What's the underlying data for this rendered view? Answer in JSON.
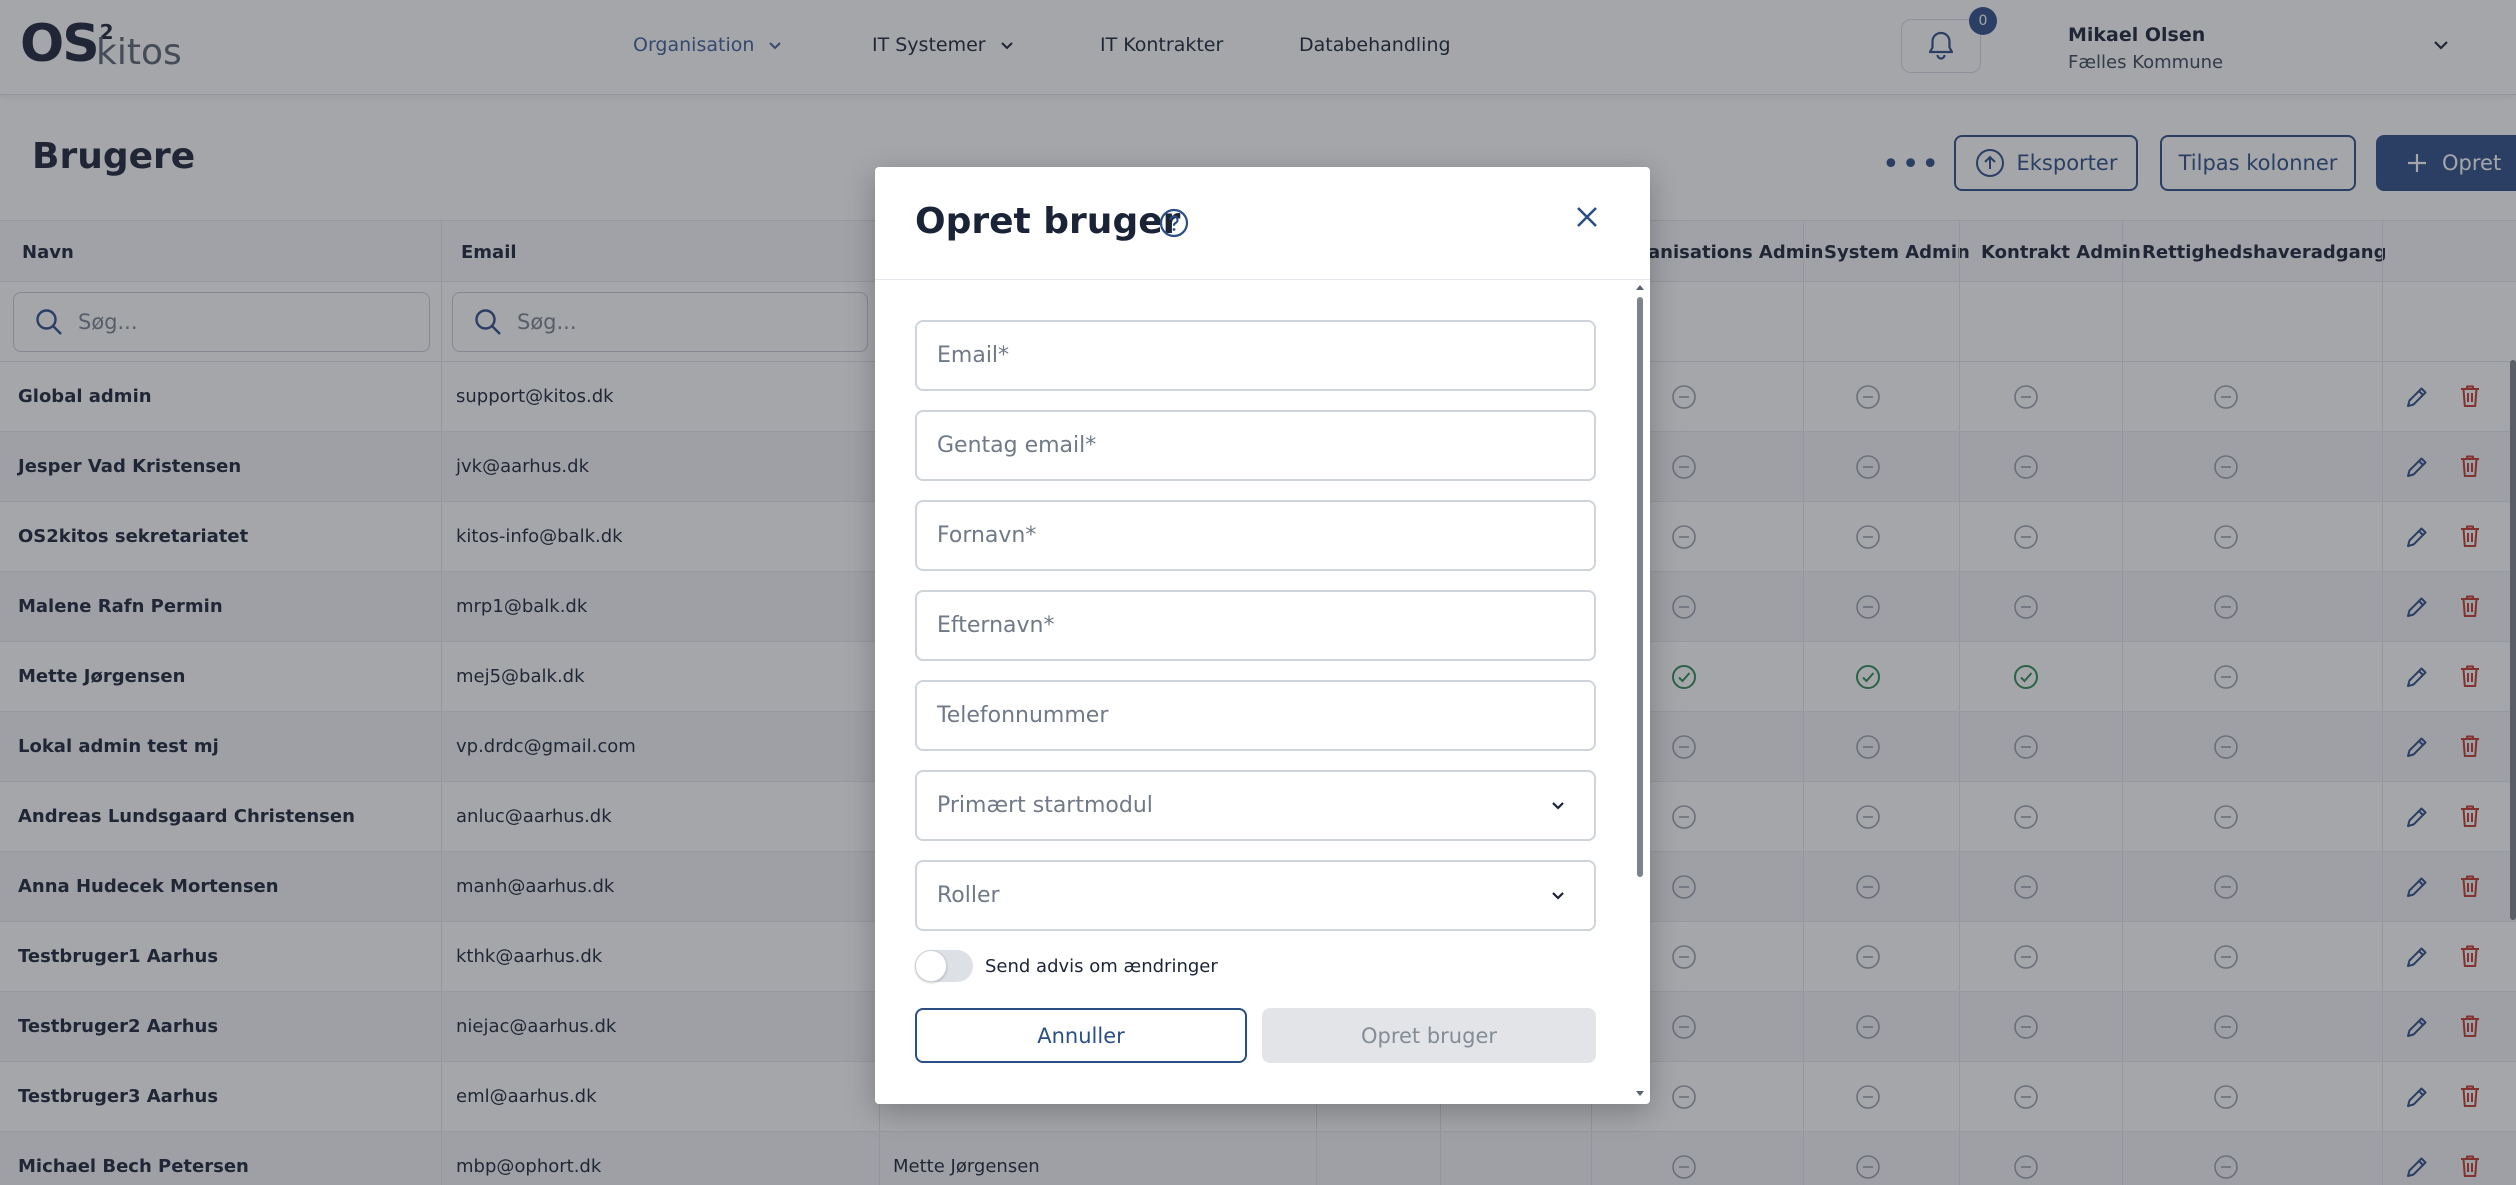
{
  "header": {
    "logo_text": "OS",
    "logo_sup": "2",
    "logo_sub": "kitos",
    "nav": [
      {
        "label": "Organisation",
        "active": true,
        "dropdown": true
      },
      {
        "label": "IT Systemer",
        "active": false,
        "dropdown": true
      },
      {
        "label": "IT Kontrakter",
        "active": false,
        "dropdown": false
      },
      {
        "label": "Databehandling",
        "active": false,
        "dropdown": false
      }
    ],
    "notifications_count": "0",
    "user_name": "Mikael Olsen",
    "user_org": "Fælles Kommune"
  },
  "page": {
    "title": "Brugere",
    "more_icon": "ellipsis-icon",
    "export_label": "Eksporter",
    "columns_label": "Tilpas kolonner",
    "create_label": "Opret"
  },
  "table": {
    "headers": [
      "Navn",
      "Email",
      "anisations Admin",
      "System Admin",
      "Kontrakt Admin",
      "Rettighedshaveradgang"
    ],
    "search_placeholder": "Søg...",
    "rows": [
      {
        "name": "Global admin",
        "email": "support@kitos.dk",
        "extra": "",
        "checks": [
          false,
          false,
          false,
          false
        ]
      },
      {
        "name": "Jesper Vad Kristensen",
        "email": "jvk@aarhus.dk",
        "extra": "",
        "checks": [
          false,
          false,
          false,
          false
        ]
      },
      {
        "name": "OS2kitos sekretariatet",
        "email": "kitos-info@balk.dk",
        "extra": "",
        "checks": [
          false,
          false,
          false,
          false
        ]
      },
      {
        "name": "Malene Rafn Permin",
        "email": "mrp1@balk.dk",
        "extra": "",
        "checks": [
          false,
          false,
          false,
          false
        ]
      },
      {
        "name": "Mette Jørgensen",
        "email": "mej5@balk.dk",
        "extra": "",
        "checks": [
          true,
          true,
          true,
          false
        ]
      },
      {
        "name": "Lokal admin test mj",
        "email": "vp.drdc@gmail.com",
        "extra": "",
        "checks": [
          false,
          false,
          false,
          false
        ]
      },
      {
        "name": "Andreas Lundsgaard Christensen",
        "email": "anluc@aarhus.dk",
        "extra": "",
        "checks": [
          false,
          false,
          false,
          false
        ]
      },
      {
        "name": "Anna Hudecek Mortensen",
        "email": "manh@aarhus.dk",
        "extra": "",
        "checks": [
          false,
          false,
          false,
          false
        ]
      },
      {
        "name": "Testbruger1 Aarhus",
        "email": "kthk@aarhus.dk",
        "extra": "",
        "checks": [
          false,
          false,
          false,
          false
        ]
      },
      {
        "name": "Testbruger2 Aarhus",
        "email": "niejac@aarhus.dk",
        "extra": "",
        "checks": [
          false,
          false,
          false,
          false
        ]
      },
      {
        "name": "Testbruger3 Aarhus",
        "email": "eml@aarhus.dk",
        "extra": "",
        "checks": [
          false,
          false,
          false,
          false
        ]
      },
      {
        "name": "Michael Bech Petersen",
        "email": "mbp@ophort.dk",
        "extra": "Mette Jørgensen",
        "checks": [
          false,
          false,
          false,
          false
        ]
      }
    ]
  },
  "modal": {
    "title": "Opret bruger",
    "fields": [
      {
        "placeholder": "Email*",
        "type": "text"
      },
      {
        "placeholder": "Gentag email*",
        "type": "text"
      },
      {
        "placeholder": "Fornavn*",
        "type": "text"
      },
      {
        "placeholder": "Efternavn*",
        "type": "text"
      },
      {
        "placeholder": "Telefonnummer",
        "type": "text"
      },
      {
        "placeholder": "Primært startmodul",
        "type": "select"
      },
      {
        "placeholder": "Roller",
        "type": "select"
      }
    ],
    "toggle_label": "Send advis om ændringer",
    "cancel_label": "Annuller",
    "submit_label": "Opret bruger"
  },
  "colors": {
    "primary": "#2b4f85",
    "check_green": "#2e8b57",
    "delete_red": "#c0392b",
    "neutral_icon": "#9aa1ab"
  }
}
